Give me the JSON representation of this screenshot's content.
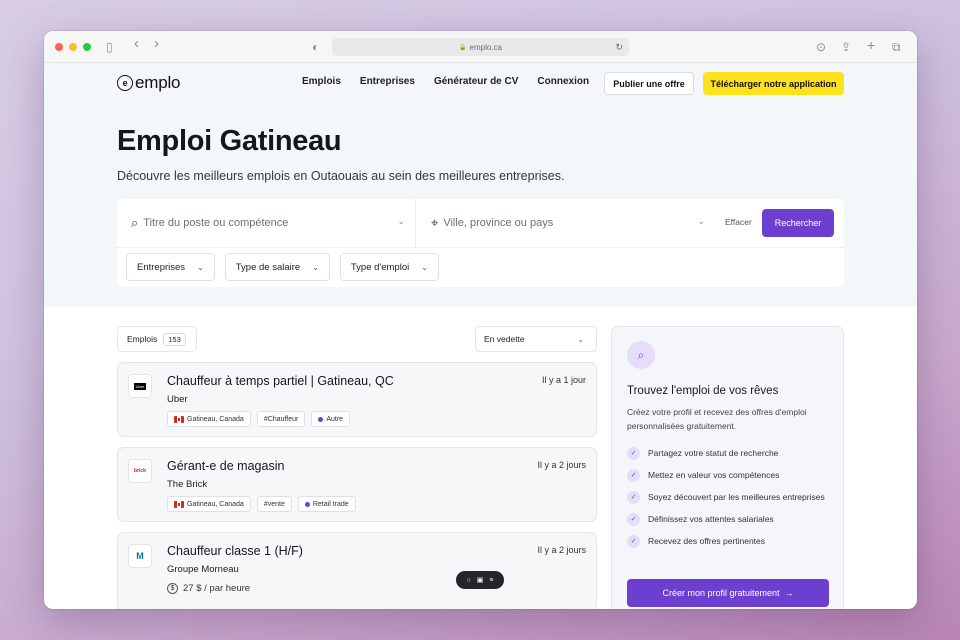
{
  "browser": {
    "url": "emplo.ca",
    "traffic_colors": [
      "#ff5f57",
      "#febc2e",
      "#28c840"
    ],
    "icons": {
      "sidebar": "▯",
      "back": "‹",
      "forward": "›",
      "shield": "◐",
      "lock": "🔒",
      "reload": "↻",
      "download": "⊙",
      "share": "⇪",
      "newtab": "+",
      "tabs": "⧉"
    }
  },
  "nav": {
    "logo": "emplo",
    "logo_mark": "e",
    "links": [
      "Emplois",
      "Entreprises",
      "Générateur de CV",
      "Connexion"
    ],
    "post_offer": "Publier une offre",
    "download_app": "Télécharger notre application"
  },
  "hero": {
    "title": "Emploi Gatineau",
    "subtitle": "Découvre les meilleurs emplois en Outaouais au sein des meilleures entreprises."
  },
  "search": {
    "title_placeholder": "Titre du poste ou compétence",
    "location_placeholder": "Ville, province ou pays",
    "clear": "Effacer",
    "submit": "Rechercher",
    "filters": [
      "Entreprises",
      "Type de salaire",
      "Type d'emploi"
    ]
  },
  "list": {
    "label": "Emplois",
    "count": "153",
    "sort": "En vedette"
  },
  "jobs": [
    {
      "title": "Chauffeur à temps partiel | Gatineau, QC",
      "company": "Uber",
      "time": "Il y a 1 jour",
      "location": "Gatineau, Canada",
      "tag": "#Chauffeur",
      "category": "Autre",
      "logo_text": "Uber"
    },
    {
      "title": "Gérant-e de magasin",
      "company": "The Brick",
      "time": "Il y a 2 jours",
      "location": "Gatineau, Canada",
      "tag": "#vente",
      "category": "Retail trade",
      "logo_text": "brick"
    },
    {
      "title": "Chauffeur classe 1 (H/F)",
      "company": "Groupe Morneau",
      "time": "Il y a 2 jours",
      "salary": "27 $ / par heure",
      "logo_text": "M"
    }
  ],
  "side": {
    "title": "Trouvez l'emploi de vos rêves",
    "description": "Créez votre profil et recevez des offres d'emploi personnalisées gratuitement.",
    "benefits": [
      "Partagez votre statut de recherche",
      "Mettez en valeur vos compétences",
      "Soyez découvert par les meilleures entreprises",
      "Définissez vos attentes salariales",
      "Recevez des offres pertinentes"
    ],
    "cta": "Créer mon profil gratuitement"
  },
  "colors": {
    "accent": "#6d3fd0",
    "yellow": "#fde21c",
    "hero_bg": "#f3f7fa"
  }
}
